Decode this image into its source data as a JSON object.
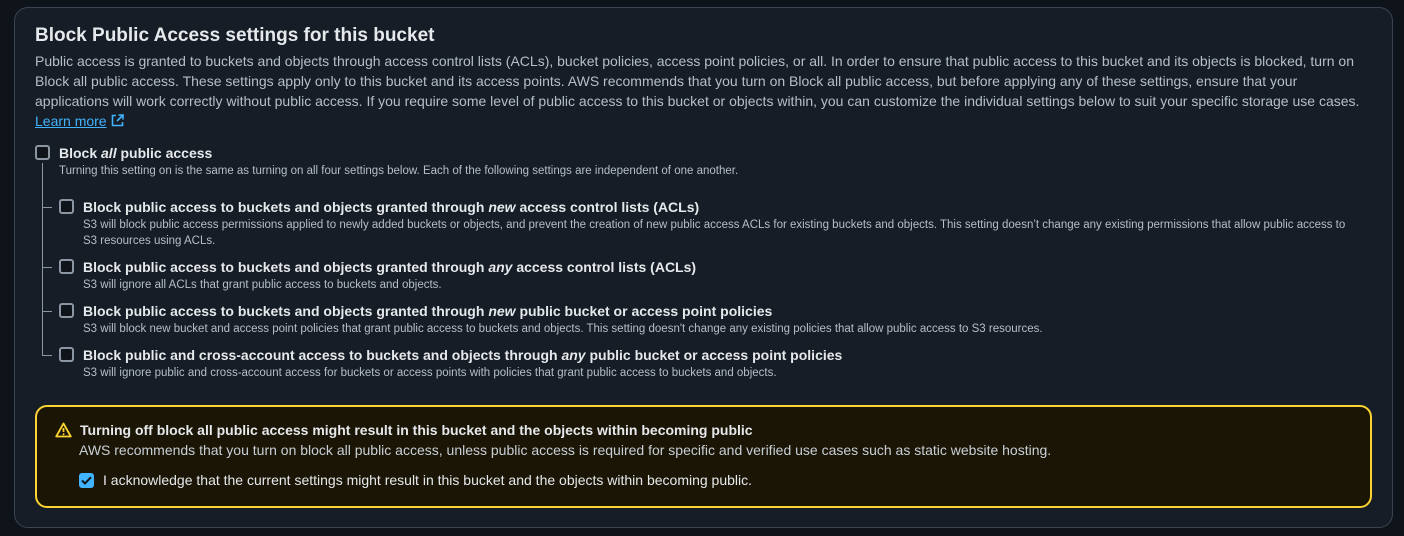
{
  "section": {
    "title": "Block Public Access settings for this bucket",
    "description": "Public access is granted to buckets and objects through access control lists (ACLs), bucket policies, access point policies, or all. In order to ensure that public access to this bucket and its objects is blocked, turn on Block all public access. These settings apply only to this bucket and its access points. AWS recommends that you turn on Block all public access, but before applying any of these settings, ensure that your applications will work correctly without public access. If you require some level of public access to this bucket or objects within, you can customize the individual settings below to suit your specific storage use cases.",
    "learn_more": "Learn more",
    "learn_more_icon": "external-link-icon"
  },
  "block_all": {
    "label_before": "Block",
    "label_emph": "all",
    "label_after": "public access",
    "description": "Turning this setting on is the same as turning on all four settings below. Each of the following settings are independent of one another.",
    "checked": false
  },
  "options": [
    {
      "label_before": "Block public access to buckets and objects granted through",
      "label_emph": "new",
      "label_after": "access control lists (ACLs)",
      "description": "S3 will block public access permissions applied to newly added buckets or objects, and prevent the creation of new public access ACLs for existing buckets and objects. This setting doesn’t change any existing permissions that allow public access to S3 resources using ACLs.",
      "checked": false
    },
    {
      "label_before": "Block public access to buckets and objects granted through",
      "label_emph": "any",
      "label_after": "access control lists (ACLs)",
      "description": "S3 will ignore all ACLs that grant public access to buckets and objects.",
      "checked": false
    },
    {
      "label_before": "Block public access to buckets and objects granted through",
      "label_emph": "new",
      "label_after": "public bucket or access point policies",
      "description": "S3 will block new bucket and access point policies that grant public access to buckets and objects. This setting doesn't change any existing policies that allow public access to S3 resources.",
      "checked": false
    },
    {
      "label_before": "Block public and cross-account access to buckets and objects through",
      "label_emph": "any",
      "label_after": "public bucket or access point policies",
      "description": "S3 will ignore public and cross-account access for buckets or access points with policies that grant public access to buckets and objects.",
      "checked": false
    }
  ],
  "warning": {
    "icon": "warning-triangle-icon",
    "title": "Turning off block all public access might result in this bucket and the objects within becoming public",
    "body": "AWS recommends that you turn on block all public access, unless public access is required for specific and verified use cases such as static website hosting.",
    "acknowledge_label": "I acknowledge that the current settings might result in this bucket and the objects within becoming public.",
    "acknowledge_checked": true
  },
  "colors": {
    "accent": "#42b4ff",
    "warning": "#fbd332",
    "panel_bg": "#161d26",
    "page_bg": "#0f141a"
  }
}
